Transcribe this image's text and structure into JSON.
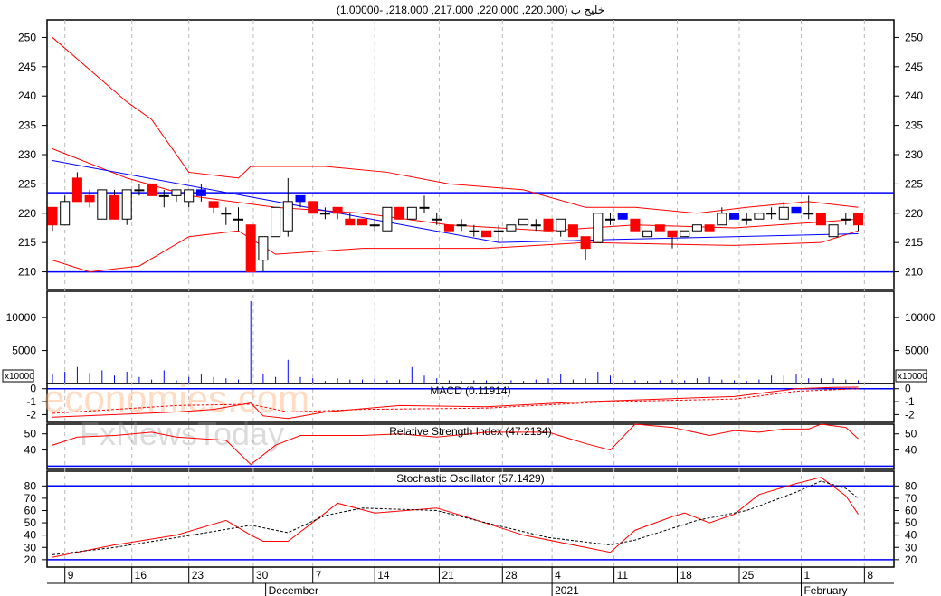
{
  "header": {
    "title": "خليج ب (220.000, 220.000, 217.000, 218.000, -1.00000)"
  },
  "watermark": {
    "line1": "economies.com",
    "line2": "FxNewsToday"
  },
  "colors": {
    "up": "#ffffff",
    "down": "#ff0000",
    "neutral": "#0000ff",
    "band": "#ff0000",
    "trend": "#0000ff"
  },
  "chart_data": [
    {
      "type": "candlestick",
      "name": "price",
      "yticks": [
        210,
        215,
        220,
        225,
        230,
        235,
        240,
        245,
        250
      ],
      "ylim": [
        207,
        253
      ],
      "hlines": [
        223.5,
        210
      ],
      "candles": [
        [
          221,
          221,
          217,
          218,
          "r"
        ],
        [
          218,
          223,
          218,
          222,
          "w"
        ],
        [
          226,
          227,
          222,
          222,
          "r"
        ],
        [
          223,
          224,
          221,
          222,
          "r"
        ],
        [
          219,
          224,
          219,
          224,
          "w"
        ],
        [
          223,
          224,
          219,
          219,
          "r"
        ],
        [
          219,
          224,
          218,
          224,
          "w"
        ],
        [
          224,
          225,
          223,
          224,
          "w"
        ],
        [
          225,
          225,
          223,
          223,
          "r"
        ],
        [
          223,
          224,
          221,
          223,
          "w"
        ],
        [
          223,
          224,
          222,
          224,
          "w"
        ],
        [
          222,
          224,
          221,
          224,
          "w"
        ],
        [
          224,
          225,
          222,
          223,
          "b"
        ],
        [
          222,
          222,
          220,
          221,
          "r"
        ],
        [
          220,
          221,
          218,
          220,
          "w"
        ],
        [
          219,
          221,
          217,
          219,
          "w"
        ],
        [
          218,
          218,
          210,
          210,
          "r"
        ],
        [
          212,
          216,
          210,
          216,
          "w"
        ],
        [
          216,
          221,
          216,
          221,
          "w"
        ],
        [
          217,
          226,
          216,
          222,
          "w"
        ],
        [
          223,
          223,
          221,
          222,
          "b"
        ],
        [
          222,
          222,
          220,
          220,
          "r"
        ],
        [
          220,
          221,
          219,
          220,
          "w"
        ],
        [
          221,
          221,
          219,
          220,
          "r"
        ],
        [
          219,
          220,
          218,
          218,
          "r"
        ],
        [
          219,
          219,
          218,
          218,
          "r"
        ],
        [
          218,
          219,
          217,
          218,
          "w"
        ],
        [
          217,
          221,
          217,
          221,
          "w"
        ],
        [
          221,
          221,
          219,
          219,
          "r"
        ],
        [
          219,
          221,
          219,
          221,
          "w"
        ],
        [
          221,
          223,
          220,
          221,
          "w"
        ],
        [
          219,
          220,
          218,
          219,
          "w"
        ],
        [
          218,
          218,
          217,
          217,
          "r"
        ],
        [
          218,
          219,
          217,
          218,
          "w"
        ],
        [
          217,
          218,
          216,
          217,
          "w"
        ],
        [
          217,
          217,
          216,
          216,
          "r"
        ],
        [
          217,
          218,
          215,
          217,
          "w"
        ],
        [
          217,
          218,
          217,
          218,
          "w"
        ],
        [
          218,
          219,
          218,
          219,
          "w"
        ],
        [
          218,
          219,
          217,
          218,
          "w"
        ],
        [
          219,
          219,
          217,
          217,
          "r"
        ],
        [
          217,
          219,
          216,
          219,
          "w"
        ],
        [
          218,
          218,
          216,
          216,
          "r"
        ],
        [
          216,
          216,
          212,
          214,
          "r"
        ],
        [
          215,
          220,
          215,
          220,
          "w"
        ],
        [
          219,
          220,
          218,
          219,
          "w"
        ],
        [
          220,
          220,
          219,
          219,
          "b"
        ],
        [
          219,
          219,
          217,
          217,
          "r"
        ],
        [
          216,
          217,
          216,
          217,
          "w"
        ],
        [
          218,
          218,
          217,
          217,
          "r"
        ],
        [
          217,
          217,
          214,
          216,
          "r"
        ],
        [
          216,
          217,
          216,
          217,
          "w"
        ],
        [
          217,
          218,
          217,
          218,
          "w"
        ],
        [
          218,
          218,
          217,
          217,
          "r"
        ],
        [
          218,
          221,
          218,
          220,
          "w"
        ],
        [
          220,
          220,
          219,
          219,
          "b"
        ],
        [
          219,
          220,
          218,
          219,
          "w"
        ],
        [
          219,
          220,
          219,
          220,
          "w"
        ],
        [
          220,
          221,
          219,
          220,
          "w"
        ],
        [
          219,
          222,
          219,
          221,
          "w"
        ],
        [
          221,
          221,
          220,
          220,
          "b"
        ],
        [
          220,
          223,
          219,
          220,
          "w"
        ],
        [
          220,
          220,
          218,
          218,
          "r"
        ],
        [
          216,
          218,
          216,
          218,
          "w"
        ],
        [
          219,
          220,
          218,
          219,
          "w"
        ],
        [
          220,
          220,
          217,
          218,
          "r"
        ]
      ],
      "bollinger_upper": [
        [
          0,
          250
        ],
        [
          6,
          239
        ],
        [
          8,
          236
        ],
        [
          11,
          227
        ],
        [
          15,
          226
        ],
        [
          16,
          228
        ],
        [
          22,
          228
        ],
        [
          27,
          227
        ],
        [
          32,
          225
        ],
        [
          38,
          224
        ],
        [
          43,
          221
        ],
        [
          47,
          221
        ],
        [
          52,
          220
        ],
        [
          56,
          221
        ],
        [
          61,
          222
        ],
        [
          65,
          221
        ]
      ],
      "bollinger_mid": [
        [
          0,
          231
        ],
        [
          6,
          226
        ],
        [
          11,
          223
        ],
        [
          18,
          221
        ],
        [
          25,
          220
        ],
        [
          32,
          218
        ],
        [
          40,
          217
        ],
        [
          47,
          218
        ],
        [
          55,
          217.5
        ],
        [
          62,
          218.5
        ],
        [
          65,
          219
        ]
      ],
      "bollinger_lower": [
        [
          0,
          212
        ],
        [
          3,
          210
        ],
        [
          7,
          211
        ],
        [
          11,
          216
        ],
        [
          15,
          217
        ],
        [
          18,
          213
        ],
        [
          25,
          214
        ],
        [
          35,
          214
        ],
        [
          43,
          215
        ],
        [
          55,
          214.5
        ],
        [
          62,
          215
        ],
        [
          65,
          217
        ]
      ],
      "trendline": [
        [
          0,
          229
        ],
        [
          36,
          215
        ],
        [
          45,
          215.5
        ],
        [
          65,
          216.5
        ]
      ]
    },
    {
      "type": "bar",
      "name": "volume",
      "unit_label": "x10000",
      "yticks": [
        5000,
        10000
      ],
      "ylim": [
        0,
        14000
      ],
      "values": [
        1.5,
        1.8,
        2.5,
        1.6,
        2,
        1.2,
        1.8,
        1,
        0.6,
        2,
        0.5,
        1,
        1.5,
        1,
        0.8,
        0.6,
        12.5,
        1.4,
        1,
        3.6,
        1,
        0.8,
        0.4,
        0.8,
        0.6,
        0.6,
        0.8,
        0.5,
        0.6,
        2.5,
        1.2,
        0.8,
        0.5,
        0.4,
        0.5,
        0.5,
        0.4,
        0.5,
        0.4,
        0.6,
        0.8,
        1.5,
        0.6,
        0.8,
        1.8,
        1.2,
        0.6,
        0.5,
        0.4,
        0.5,
        0.6,
        0.5,
        0.8,
        1,
        0.6,
        0.5,
        0.4,
        0.6,
        1.2,
        1.2,
        1.5,
        0.8,
        0.8,
        0.8,
        0.6,
        0.5
      ]
    },
    {
      "type": "line",
      "name": "macd",
      "title": "MACD (0.11914)",
      "yticks": [
        0,
        -1,
        -2
      ],
      "ylim": [
        -2.6,
        0.4
      ],
      "series": [
        {
          "name": "MACD",
          "style": "solid",
          "points": [
            [
              0,
              -2.2
            ],
            [
              5,
              -2
            ],
            [
              10,
              -1.8
            ],
            [
              13,
              -1.6
            ],
            [
              16,
              -1.1
            ],
            [
              17,
              -2.1
            ],
            [
              19,
              -2.3
            ],
            [
              22,
              -1.8
            ],
            [
              28,
              -1.3
            ],
            [
              35,
              -1.4
            ],
            [
              43,
              -1
            ],
            [
              49,
              -0.8
            ],
            [
              55,
              -0.6
            ],
            [
              60,
              0
            ],
            [
              63,
              0.1
            ],
            [
              65,
              0.12
            ]
          ]
        },
        {
          "name": "Signal",
          "style": "dashed",
          "points": [
            [
              0,
              -1.9
            ],
            [
              10,
              -1.3
            ],
            [
              16,
              -1.2
            ],
            [
              19,
              -1.8
            ],
            [
              25,
              -1.6
            ],
            [
              35,
              -1.5
            ],
            [
              45,
              -1
            ],
            [
              55,
              -0.8
            ],
            [
              60,
              -0.2
            ],
            [
              65,
              0
            ]
          ]
        }
      ]
    },
    {
      "type": "line",
      "name": "rsi",
      "title": "Relative Strength Index (47.2134)",
      "yticks": [
        40,
        50
      ],
      "ylim": [
        28,
        56
      ],
      "hlines": [
        30
      ],
      "series": [
        {
          "name": "RSI",
          "style": "solid",
          "points": [
            [
              0,
              43
            ],
            [
              2,
              48
            ],
            [
              5,
              49
            ],
            [
              8,
              51
            ],
            [
              10,
              48
            ],
            [
              14,
              46
            ],
            [
              16,
              31
            ],
            [
              18,
              43
            ],
            [
              20,
              49
            ],
            [
              25,
              49
            ],
            [
              28,
              50
            ],
            [
              31,
              48
            ],
            [
              35,
              51
            ],
            [
              40,
              51
            ],
            [
              43,
              44
            ],
            [
              45,
              40
            ],
            [
              47,
              56
            ],
            [
              50,
              54
            ],
            [
              53,
              49
            ],
            [
              55,
              52
            ],
            [
              57,
              51
            ],
            [
              59,
              53
            ],
            [
              61,
              53
            ],
            [
              62,
              56
            ],
            [
              64,
              54
            ],
            [
              65,
              47
            ]
          ]
        }
      ]
    },
    {
      "type": "line",
      "name": "stochastic",
      "title": "Stochastic Oscillator (57.1429)",
      "yticks": [
        20,
        30,
        40,
        50,
        60,
        70,
        80
      ],
      "ylim": [
        14,
        92
      ],
      "hlines": [
        80,
        20
      ],
      "series": [
        {
          "name": "%K",
          "style": "solid",
          "points": [
            [
              0,
              22
            ],
            [
              5,
              32
            ],
            [
              10,
              40
            ],
            [
              14,
              52
            ],
            [
              16,
              40
            ],
            [
              17,
              35
            ],
            [
              19,
              35
            ],
            [
              22,
              58
            ],
            [
              23,
              66
            ],
            [
              26,
              58
            ],
            [
              31,
              62
            ],
            [
              33,
              56
            ],
            [
              38,
              40
            ],
            [
              43,
              30
            ],
            [
              45,
              26
            ],
            [
              47,
              44
            ],
            [
              50,
              55
            ],
            [
              51,
              58
            ],
            [
              53,
              50
            ],
            [
              55,
              57
            ],
            [
              57,
              73
            ],
            [
              60,
              82
            ],
            [
              62,
              87
            ],
            [
              64,
              72
            ],
            [
              65,
              57
            ]
          ]
        },
        {
          "name": "%D",
          "style": "dashed",
          "points": [
            [
              0,
              24
            ],
            [
              5,
              30
            ],
            [
              10,
              38
            ],
            [
              16,
              48
            ],
            [
              19,
              42
            ],
            [
              22,
              56
            ],
            [
              25,
              62
            ],
            [
              31,
              60
            ],
            [
              35,
              50
            ],
            [
              40,
              38
            ],
            [
              45,
              32
            ],
            [
              47,
              36
            ],
            [
              52,
              52
            ],
            [
              56,
              60
            ],
            [
              60,
              75
            ],
            [
              62,
              84
            ],
            [
              64,
              78
            ],
            [
              65,
              70
            ]
          ]
        }
      ]
    }
  ],
  "xaxis": {
    "ticks": [
      {
        "i": 1,
        "label": "9"
      },
      {
        "i": 6.4,
        "label": "16"
      },
      {
        "i": 11,
        "label": "23"
      },
      {
        "i": 16.2,
        "label": "30"
      },
      {
        "i": 21,
        "label": "7"
      },
      {
        "i": 26,
        "label": "14"
      },
      {
        "i": 31.2,
        "label": "21"
      },
      {
        "i": 36.3,
        "label": "28"
      },
      {
        "i": 40.3,
        "label": "4"
      },
      {
        "i": 45.3,
        "label": "11"
      },
      {
        "i": 50.4,
        "label": "18"
      },
      {
        "i": 55.4,
        "label": "25"
      },
      {
        "i": 60.4,
        "label": "1"
      },
      {
        "i": 65.5,
        "label": "8"
      }
    ],
    "months": [
      {
        "i": 17.2,
        "label": "December"
      },
      {
        "i": 40.3,
        "label": "2021"
      },
      {
        "i": 60.4,
        "label": "February"
      }
    ]
  }
}
